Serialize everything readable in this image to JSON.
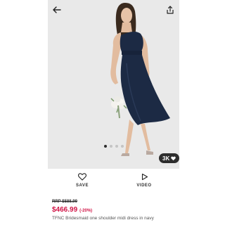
{
  "actions": {
    "save_label": "SAVE",
    "video_label": "VIDEO"
  },
  "gallery": {
    "save_count": "3K",
    "dots": [
      true,
      false,
      false,
      false
    ]
  },
  "product": {
    "rrp": "RRP $588.99",
    "price": "$466.99",
    "discount": "(-20%)",
    "title": "TFNC Bridesmaid one shoulder midi dress in navy"
  },
  "colors": {
    "price": "#d01345",
    "dress": "#1c2a44",
    "backdrop": "#e9e9e9"
  },
  "icons": [
    "back-arrow-icon",
    "share-icon",
    "heart-icon",
    "play-icon"
  ]
}
